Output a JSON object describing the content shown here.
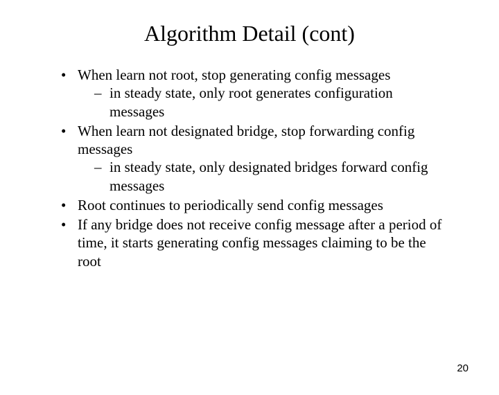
{
  "title": "Algorithm Detail (cont)",
  "bullets": [
    {
      "text": "When learn not root, stop generating config messages",
      "sub": [
        {
          "text": "in steady state, only root generates configuration messages"
        }
      ]
    },
    {
      "text": "When learn not designated bridge, stop forwarding config messages",
      "sub": [
        {
          "text": "in steady state, only designated bridges forward config messages"
        }
      ]
    },
    {
      "text": "Root continues to periodically send config messages",
      "sub": []
    },
    {
      "text": "If any bridge does not receive config message after a period of time, it starts generating config messages claiming to be the root",
      "sub": []
    }
  ],
  "page_number": "20"
}
